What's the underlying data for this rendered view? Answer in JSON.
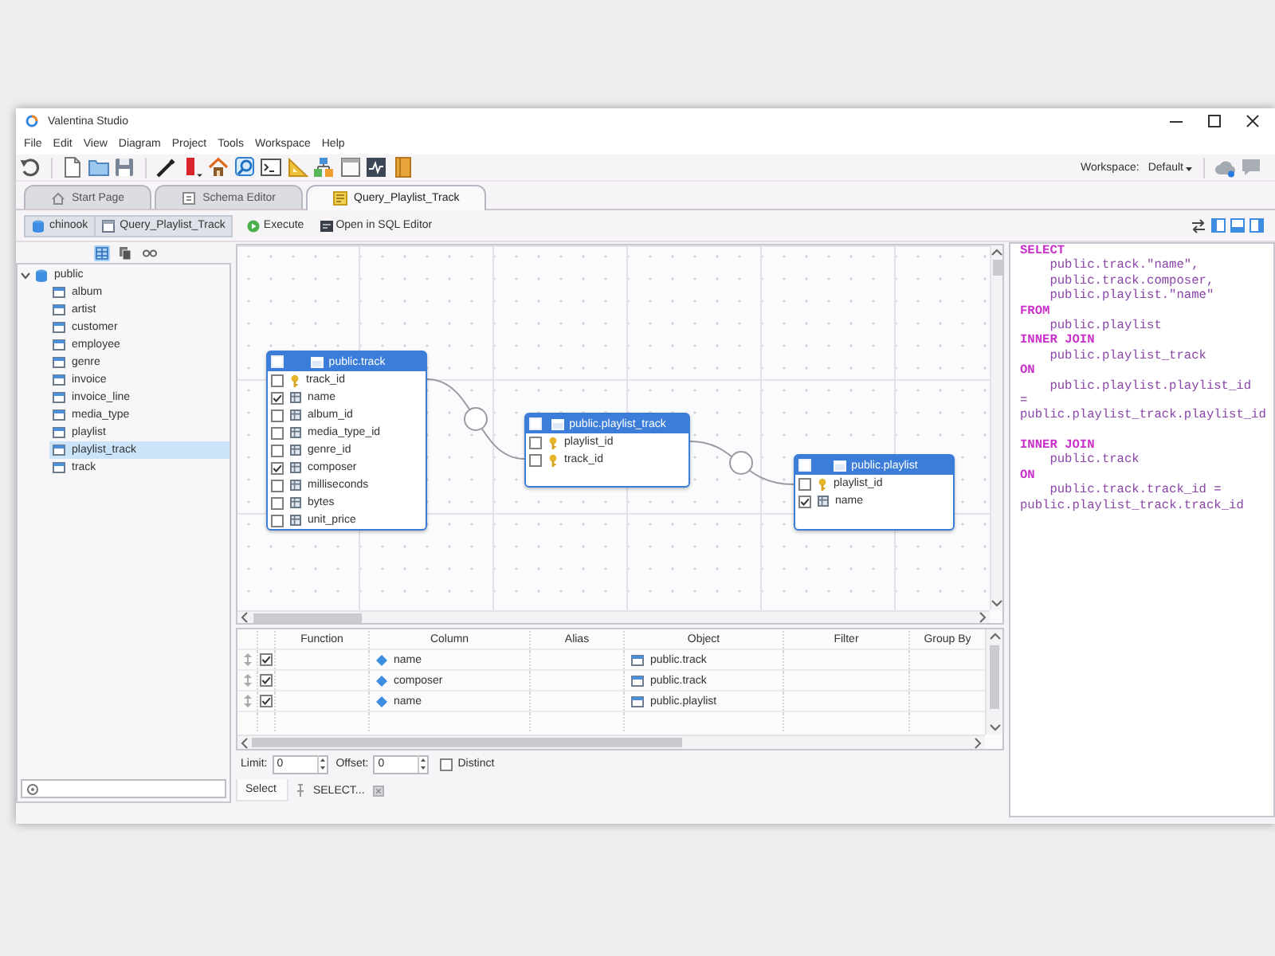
{
  "window": {
    "title": "Valentina Studio"
  },
  "menu": [
    "File",
    "Edit",
    "View",
    "Diagram",
    "Project",
    "Tools",
    "Workspace",
    "Help"
  ],
  "workspace": {
    "label": "Workspace:",
    "value": "Default"
  },
  "tabs": [
    {
      "label": "Start Page",
      "selected": false
    },
    {
      "label": "Schema Editor",
      "selected": false
    },
    {
      "label": "Query_Playlist_Track",
      "selected": true
    }
  ],
  "query_toolbar": {
    "breadcrumb": [
      "chinook",
      "Query_Playlist_Track"
    ],
    "actions": [
      {
        "kind": "execute",
        "label": "Execute"
      },
      {
        "kind": "open_sql",
        "label": "Open in SQL Editor"
      }
    ]
  },
  "schema_tree": {
    "view_modes": [
      {
        "selected": true
      },
      {
        "selected": false
      },
      {
        "selected": false
      }
    ],
    "items": [
      {
        "label": "public",
        "selected": false,
        "expanded": true,
        "children": [
          {
            "label": "album",
            "selected": false
          },
          {
            "label": "artist",
            "selected": false
          },
          {
            "label": "customer",
            "selected": false
          },
          {
            "label": "employee",
            "selected": false
          },
          {
            "label": "genre",
            "selected": false
          },
          {
            "label": "invoice",
            "selected": false
          },
          {
            "label": "invoice_line",
            "selected": false
          },
          {
            "label": "media_type",
            "selected": false
          },
          {
            "label": "playlist",
            "selected": false
          },
          {
            "label": "playlist_track",
            "selected": true
          },
          {
            "label": "track",
            "selected": false
          }
        ]
      }
    ]
  },
  "diagram": {
    "tables": [
      {
        "title": "public.track",
        "checked": false,
        "columns": [
          {
            "name": "track_id",
            "kind": "key",
            "checked": false
          },
          {
            "name": "name",
            "kind": "field",
            "checked": true
          },
          {
            "name": "album_id",
            "kind": "field",
            "checked": false
          },
          {
            "name": "media_type_id",
            "kind": "field",
            "checked": false
          },
          {
            "name": "genre_id",
            "kind": "field",
            "checked": false
          },
          {
            "name": "composer",
            "kind": "field",
            "checked": true
          },
          {
            "name": "milliseconds",
            "kind": "field",
            "checked": false
          },
          {
            "name": "bytes",
            "kind": "field",
            "checked": false
          },
          {
            "name": "unit_price",
            "kind": "field",
            "checked": false
          }
        ]
      },
      {
        "title": "public.playlist_track",
        "checked": false,
        "columns": [
          {
            "name": "playlist_id",
            "kind": "key",
            "checked": false
          },
          {
            "name": "track_id",
            "kind": "key",
            "checked": false
          }
        ]
      },
      {
        "title": "public.playlist",
        "checked": false,
        "columns": [
          {
            "name": "playlist_id",
            "kind": "key",
            "checked": false
          },
          {
            "name": "name",
            "kind": "field",
            "checked": true
          }
        ]
      }
    ]
  },
  "query_grid": {
    "columns": [
      "Function",
      "Column",
      "Alias",
      "Object",
      "Filter",
      "Group By"
    ],
    "rows": [
      {
        "checked": true,
        "column": "name",
        "object": "public.track"
      },
      {
        "checked": true,
        "column": "composer",
        "object": "public.track"
      },
      {
        "checked": true,
        "column": "name",
        "object": "public.playlist"
      }
    ]
  },
  "options": {
    "limit": {
      "label": "Limit:",
      "value": "0"
    },
    "offset": {
      "label": "Offset:",
      "value": "0"
    },
    "distinct": {
      "label": "Distinct",
      "checked": false
    }
  },
  "bottom_tabs": [
    {
      "label": "Select",
      "selected": true,
      "closable": false
    },
    {
      "label": "SELECT...",
      "selected": false,
      "closable": true
    }
  ],
  "sql_editor": {
    "lines": [
      {
        "kind": "keyword",
        "text": "SELECT"
      },
      {
        "kind": "code",
        "text": "public.track.\"name\","
      },
      {
        "kind": "code",
        "text": "public.track.composer,"
      },
      {
        "kind": "code",
        "text": "public.playlist.\"name\""
      },
      {
        "kind": "keyword",
        "text": "FROM"
      },
      {
        "kind": "code",
        "text": "public.playlist"
      },
      {
        "kind": "keyword",
        "text": "INNER JOIN"
      },
      {
        "kind": "code",
        "text": "public.playlist_track"
      },
      {
        "kind": "keyword",
        "text": "ON"
      },
      {
        "kind": "code",
        "text": "public.playlist.playlist_id"
      },
      {
        "kind": "wrap",
        "text": "="
      },
      {
        "kind": "wrap",
        "text": "public.playlist_track.playlist_id"
      },
      {
        "kind": "blank"
      },
      {
        "kind": "keyword",
        "text": "INNER JOIN"
      },
      {
        "kind": "code",
        "text": "public.track"
      },
      {
        "kind": "keyword",
        "text": "ON"
      },
      {
        "kind": "code",
        "text": "public.track.track_id ="
      },
      {
        "kind": "wrap",
        "text": "public.playlist_track.track_id"
      }
    ]
  }
}
